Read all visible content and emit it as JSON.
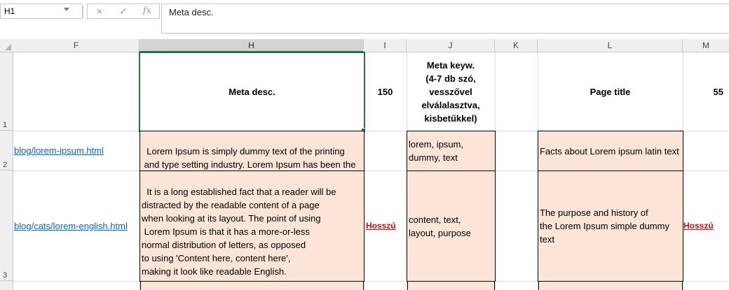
{
  "formula_bar": {
    "name_box": "H1",
    "cancel_icon": "×",
    "enter_icon": "✓",
    "fx_label": "fx",
    "formula_value": "Meta desc."
  },
  "columns": [
    "F",
    "H",
    "I",
    "J",
    "K",
    "L",
    "M"
  ],
  "rows": [
    "1",
    "2",
    "3"
  ],
  "header_row": {
    "H": "Meta desc.",
    "I": "150",
    "J": "Meta keyw.\n(4-7 db szó,\nvesszővel\nelválalasztva,\nkisbetűkkel)",
    "L": "Page title",
    "M": "55"
  },
  "row2": {
    "F": "blog/lorem-ipsum.html",
    "H": "Lorem Ipsum is simply dummy text of the printing\n and type setting industry. Lorem Ipsum has been the\nindustry's standard dummy text.",
    "J": "lorem, ipsum,\ndummy, text",
    "L": "Facts about Lorem ipsum latin text"
  },
  "row3": {
    "F": "blog/cats/lorem-english.html",
    "H": "It is a long established fact that a reader will be\ndistracted by the readable content of a page\nwhen looking at its layout. The point of using\n Lorem Ipsum is that it has a more-or-less\nnormal distribution of letters, as opposed\nto using 'Content here, content here',\nmaking it look like readable English.\n Many desktop publishing",
    "I": "Hosszú",
    "J": "content, text,\nlayout, purpose",
    "L": "The purpose and history of\nthe Lorem Ipsum simple dummy\ntext",
    "M": "Hosszú"
  },
  "colors": {
    "accent": "#217346",
    "peach": "#fce4d6",
    "link": "#0563c1",
    "warn": "#e00000"
  }
}
